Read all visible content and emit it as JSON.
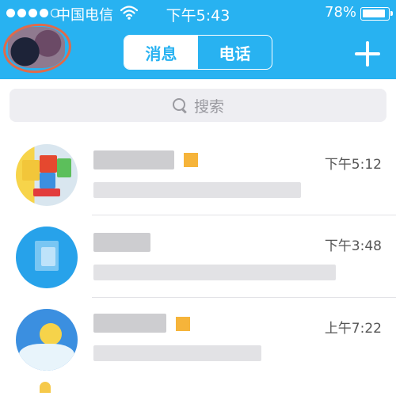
{
  "status_bar": {
    "carrier": "中国电信",
    "time": "下午5:43",
    "battery": "78%"
  },
  "header": {
    "tabs": [
      {
        "label": "消息",
        "active": true
      },
      {
        "label": "电话",
        "active": false
      }
    ]
  },
  "search": {
    "placeholder": "搜索"
  },
  "chats": [
    {
      "time": "下午5:12"
    },
    {
      "time": "下午3:48"
    },
    {
      "time": "上午7:22"
    }
  ],
  "colors": {
    "header_blue": "#28b2f1",
    "vip_orange": "#f6b43a"
  }
}
